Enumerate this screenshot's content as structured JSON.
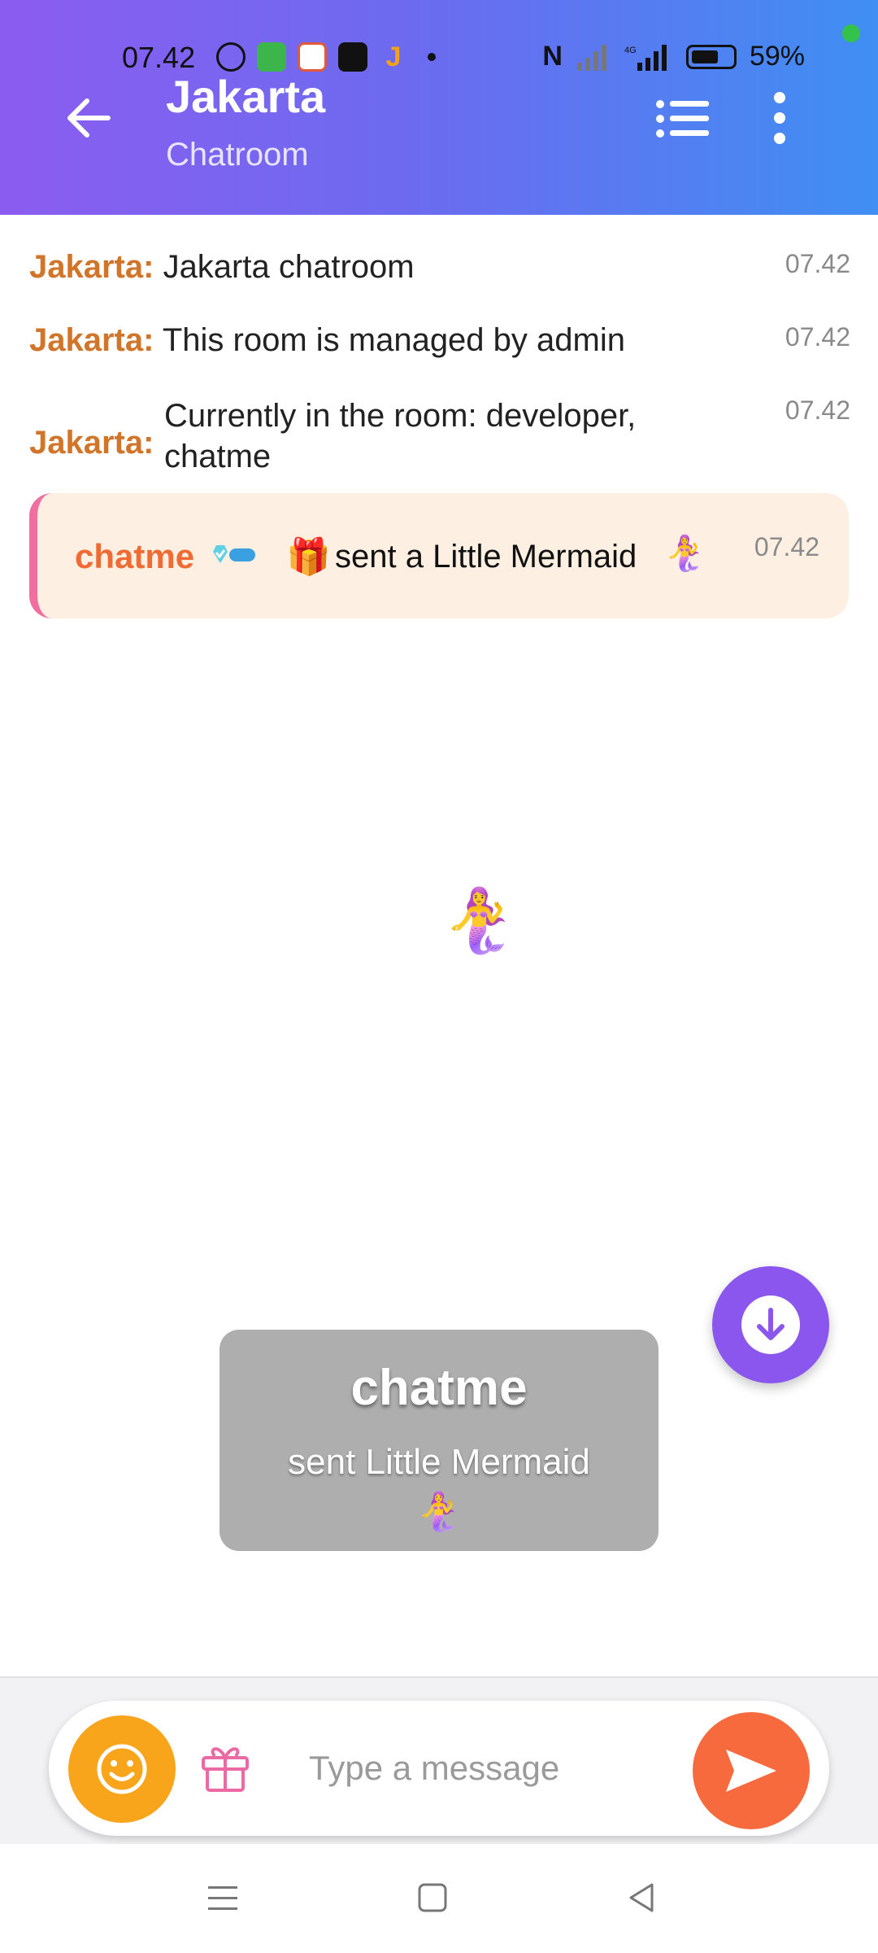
{
  "status_bar": {
    "time": "07.42",
    "battery": "59%"
  },
  "header": {
    "title": "Jakarta",
    "subtitle": "Chatroom"
  },
  "messages": [
    {
      "sender": "Jakarta:",
      "text": "Jakarta chatroom",
      "time": "07.42"
    },
    {
      "sender": "Jakarta:",
      "text": "This room is managed by admin",
      "time": "07.42"
    },
    {
      "sender": "Jakarta:",
      "text": "Currently in the room: developer, chatme",
      "time": "07.42"
    }
  ],
  "gift_message": {
    "sender": "chatme",
    "gift_emoji": "🎁",
    "text": "sent a Little Mermaid",
    "mermaid": "🧜‍♀️",
    "time": "07.42"
  },
  "animation": {
    "emoji": "🧜‍♀️"
  },
  "toast": {
    "title": "chatme",
    "line": "sent Little Mermaid",
    "emoji": "🧜‍♀️"
  },
  "composer": {
    "placeholder": "Type a message"
  },
  "colors": {
    "header_start": "#8b5cf0",
    "header_end": "#3f8ff3",
    "sender": "#d0752a",
    "gift_sender": "#f06b34",
    "emoji_button": "#f9a51b",
    "send_button": "#f76a3e",
    "scroll_button": "#8a56ee"
  },
  "icons": {
    "back": "arrow-left-icon",
    "list": "list-icon",
    "more": "more-vertical-icon",
    "scroll_down": "arrow-down-circle-icon",
    "emoji": "smiley-icon",
    "gift": "gift-icon",
    "send": "send-icon"
  }
}
